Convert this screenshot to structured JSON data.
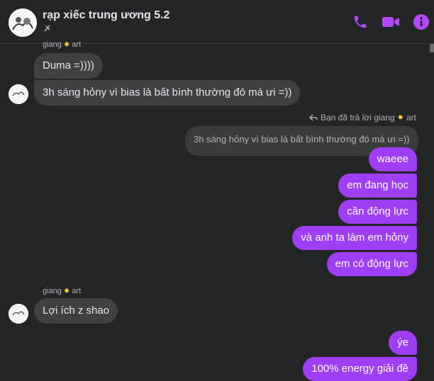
{
  "header": {
    "title": "rạp xiếc trung ương 5.2",
    "accent": "#b44af5",
    "icons": [
      "phone-icon",
      "video-icon",
      "info-icon",
      "muted-icon"
    ]
  },
  "messages": {
    "sender_name": "giang",
    "sender_suffix": "art",
    "m1": "Duma =))))",
    "m2": "3h sáng hỏny vì bias là bất bình thường đó má ưi =))",
    "reply_note": "Bạn đã trả lời giang",
    "reply_suffix": "art",
    "quoted": "3h sáng hỏny vì bias là bất bình thường đó má ưi =))",
    "o1": "waeee",
    "o2": "em đang học",
    "o3": "cần động lực",
    "o4": "và anh ta làm em hỏny",
    "o5": "em có động lực",
    "sender2_name": "giang",
    "sender2_suffix": "art",
    "m3": "Lợi ích z shao",
    "o6": "ýe",
    "o7": "100% energy giải đề"
  },
  "colors": {
    "background": "#242526",
    "incoming_bubble": "#3e4042",
    "outgoing_bubble": "#9f3ef5"
  }
}
